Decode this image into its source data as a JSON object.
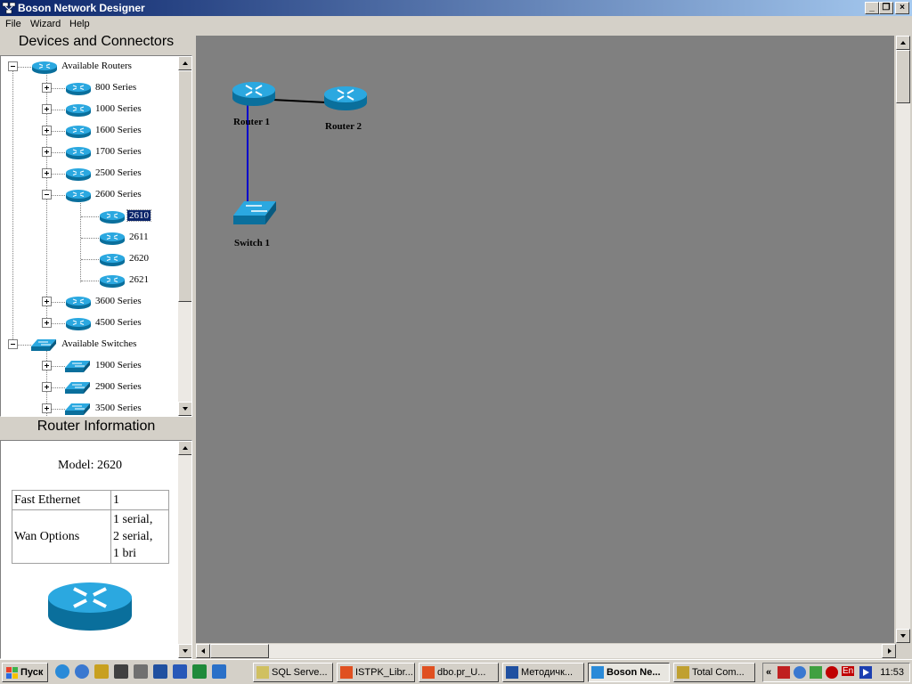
{
  "window": {
    "title": "Boson Network Designer"
  },
  "menu": [
    "File",
    "Wizard",
    "Help"
  ],
  "devices_panel": {
    "title": "Devices and Connectors",
    "tree": [
      {
        "label": "Available Routers",
        "level": 0,
        "icon": "router",
        "expander": "minus"
      },
      {
        "label": "800 Series",
        "level": 1,
        "icon": "router",
        "expander": "plus"
      },
      {
        "label": "1000 Series",
        "level": 1,
        "icon": "router",
        "expander": "plus"
      },
      {
        "label": "1600 Series",
        "level": 1,
        "icon": "router",
        "expander": "plus"
      },
      {
        "label": "1700 Series",
        "level": 1,
        "icon": "router",
        "expander": "plus"
      },
      {
        "label": "2500 Series",
        "level": 1,
        "icon": "router",
        "expander": "plus"
      },
      {
        "label": "2600 Series",
        "level": 1,
        "icon": "router",
        "expander": "minus"
      },
      {
        "label": "2610",
        "level": 2,
        "icon": "router",
        "expander": "none",
        "selected": true
      },
      {
        "label": "2611",
        "level": 2,
        "icon": "router",
        "expander": "none"
      },
      {
        "label": "2620",
        "level": 2,
        "icon": "router",
        "expander": "none"
      },
      {
        "label": "2621",
        "level": 2,
        "icon": "router",
        "expander": "none"
      },
      {
        "label": "3600 Series",
        "level": 1,
        "icon": "router",
        "expander": "plus"
      },
      {
        "label": "4500 Series",
        "level": 1,
        "icon": "router",
        "expander": "plus"
      },
      {
        "label": "Available Switches",
        "level": 0,
        "icon": "switch",
        "expander": "minus"
      },
      {
        "label": "1900 Series",
        "level": 1,
        "icon": "switch",
        "expander": "plus"
      },
      {
        "label": "2900 Series",
        "level": 1,
        "icon": "switch",
        "expander": "plus"
      },
      {
        "label": "3500 Series",
        "level": 1,
        "icon": "switch",
        "expander": "plus"
      }
    ]
  },
  "router_info": {
    "title": "Router Information",
    "model": "Model: 2620",
    "rows": [
      {
        "label": "Fast Ethernet",
        "value": "1"
      },
      {
        "label": "Wan Options",
        "value": "1 serial,\n2 serial,\n1 bri"
      }
    ]
  },
  "network": {
    "nodes": [
      {
        "id": "router1",
        "label": "Router 1",
        "type": "router"
      },
      {
        "id": "router2",
        "label": "Router 2",
        "type": "router"
      },
      {
        "id": "switch1",
        "label": "Switch 1",
        "type": "switch"
      }
    ],
    "links": [
      {
        "from": "router1",
        "to": "router2",
        "color": "#000000"
      },
      {
        "from": "router1",
        "to": "switch1",
        "color": "#0000cc"
      }
    ]
  },
  "taskbar": {
    "start_label": "Пуск",
    "tasks": [
      {
        "label": "SQL Serve...",
        "active": false
      },
      {
        "label": "ISTPK_Libr...",
        "active": false
      },
      {
        "label": "dbo.pr_U...",
        "active": false
      },
      {
        "label": "Методичк...",
        "active": false
      },
      {
        "label": "Boson Ne...",
        "active": true
      },
      {
        "label": "Total Com...",
        "active": false
      }
    ],
    "tray_lang": "En",
    "clock": "11:53"
  },
  "colors": {
    "titlebar_start": "#0a246a",
    "titlebar_end": "#a6caf0",
    "canvas_bg": "#808080",
    "device_blue": "#1e9bd7",
    "selection": "#0a246a"
  }
}
